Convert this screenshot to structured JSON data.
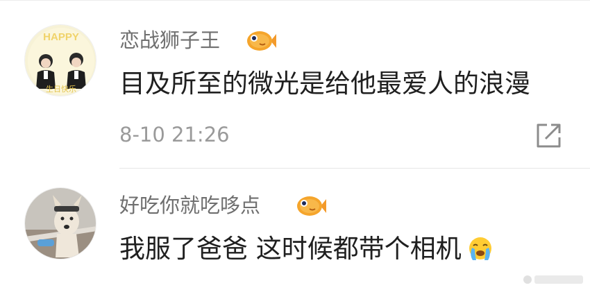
{
  "comments": [
    {
      "username": "恋战狮子王",
      "badge_icon": "fish-badge-icon",
      "text": "目及所至的微光是给他最爱人的浪漫",
      "timestamp": "8-10 21:26",
      "share_icon": "share-icon",
      "avatar_text_top": "HAPPY",
      "avatar_text_bottom": "生日快乐"
    },
    {
      "username": "好吃你就吃哆点",
      "badge_icon": "fish-badge-icon",
      "text": "我服了爸爸 这时候都带个相机",
      "emoji_icon": "crying-emoji-icon"
    }
  ],
  "colors": {
    "username": "#6f6f6f",
    "text": "#1f1f1f",
    "timestamp": "#9a9a9a",
    "fish_badge": "#f39a2b"
  }
}
